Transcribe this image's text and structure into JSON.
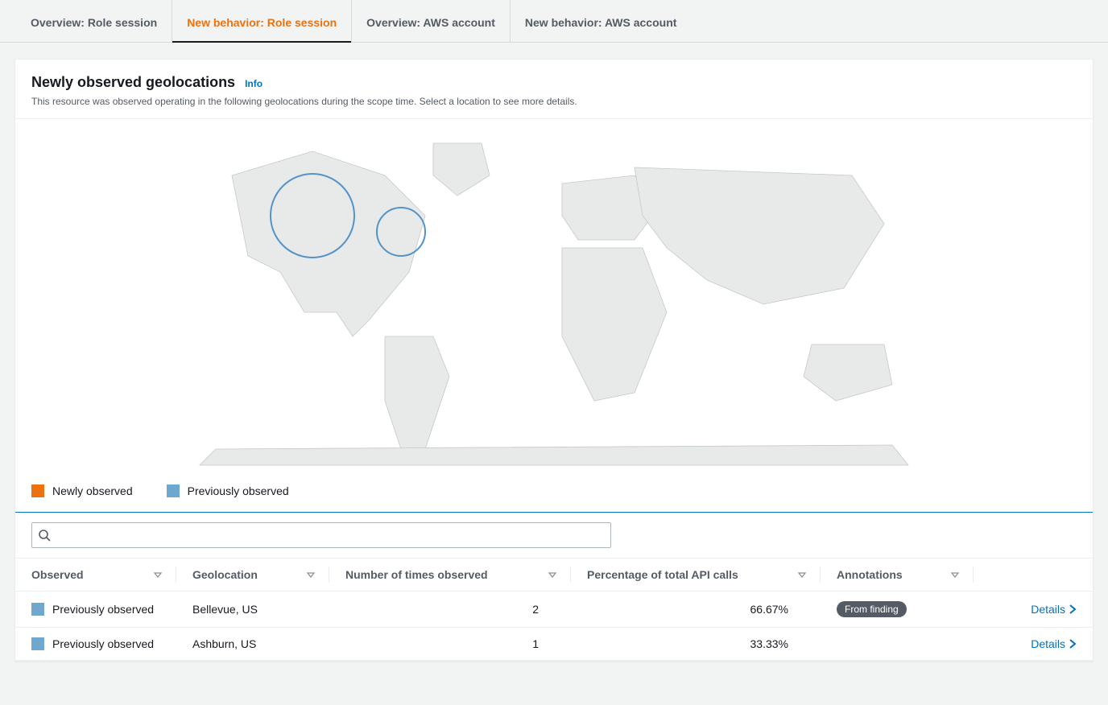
{
  "tabs": [
    {
      "label": "Overview: Role session",
      "active": false
    },
    {
      "label": "New behavior: Role session",
      "active": true
    },
    {
      "label": "Overview: AWS account",
      "active": false
    },
    {
      "label": "New behavior: AWS account",
      "active": false
    }
  ],
  "panel": {
    "title": "Newly observed geolocations",
    "info_label": "Info",
    "description": "This resource was observed operating in the following geolocations during the scope time. Select a location to see more details."
  },
  "legend": {
    "new_label": "Newly observed",
    "prev_label": "Previously observed",
    "new_color": "#ec7211",
    "prev_color": "#6ea8cf"
  },
  "search": {
    "placeholder": ""
  },
  "table": {
    "columns": {
      "observed": "Observed",
      "geolocation": "Geolocation",
      "times": "Number of times observed",
      "percentage": "Percentage of total API calls",
      "annotations": "Annotations"
    },
    "details_label": "Details",
    "rows": [
      {
        "observed_label": "Previously observed",
        "observed_color": "#6ea8cf",
        "geolocation": "Bellevue, US",
        "times": "2",
        "percentage": "66.67%",
        "annotation": "From finding"
      },
      {
        "observed_label": "Previously observed",
        "observed_color": "#6ea8cf",
        "geolocation": "Ashburn, US",
        "times": "1",
        "percentage": "33.33%",
        "annotation": ""
      }
    ]
  },
  "chart_data": {
    "type": "map",
    "title": "Newly observed geolocations",
    "series": [
      {
        "name": "Previously observed",
        "color": "#6ea8cf",
        "points": [
          {
            "label": "Bellevue, US",
            "times": 2,
            "pct": 66.67
          },
          {
            "label": "Ashburn, US",
            "times": 1,
            "pct": 33.33
          }
        ]
      },
      {
        "name": "Newly observed",
        "color": "#ec7211",
        "points": []
      }
    ]
  }
}
